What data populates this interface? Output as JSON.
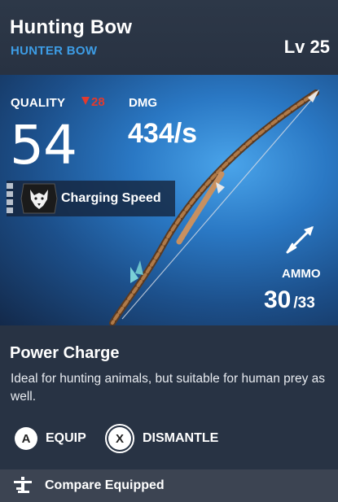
{
  "item": {
    "name": "Hunting Bow",
    "type": "HUNTER BOW",
    "level": "Lv 25"
  },
  "stats": {
    "quality_label": "QUALITY",
    "quality_delta": "28",
    "quality_value": "54",
    "dmg_label": "DMG",
    "dmg_value": "434/s",
    "ammo_label": "AMMO",
    "ammo_current": "30",
    "ammo_max": "/33"
  },
  "perk": {
    "label": "Charging Speed",
    "icon": "wolf-emblem-icon"
  },
  "ability": {
    "name": "Power Charge",
    "description": "Ideal for hunting animals, but suitable for human prey as well."
  },
  "actions": {
    "equip_button": "A",
    "equip_label": "EQUIP",
    "dismantle_button": "X",
    "dismantle_label": "DISMANTLE"
  },
  "footer": {
    "compare_label": "Compare Equipped",
    "compare_icon": "compare-icon"
  },
  "colors": {
    "accent_blue": "#3d9de6",
    "delta_red": "#e23a2e",
    "hero_blue": "#2a78c4"
  }
}
